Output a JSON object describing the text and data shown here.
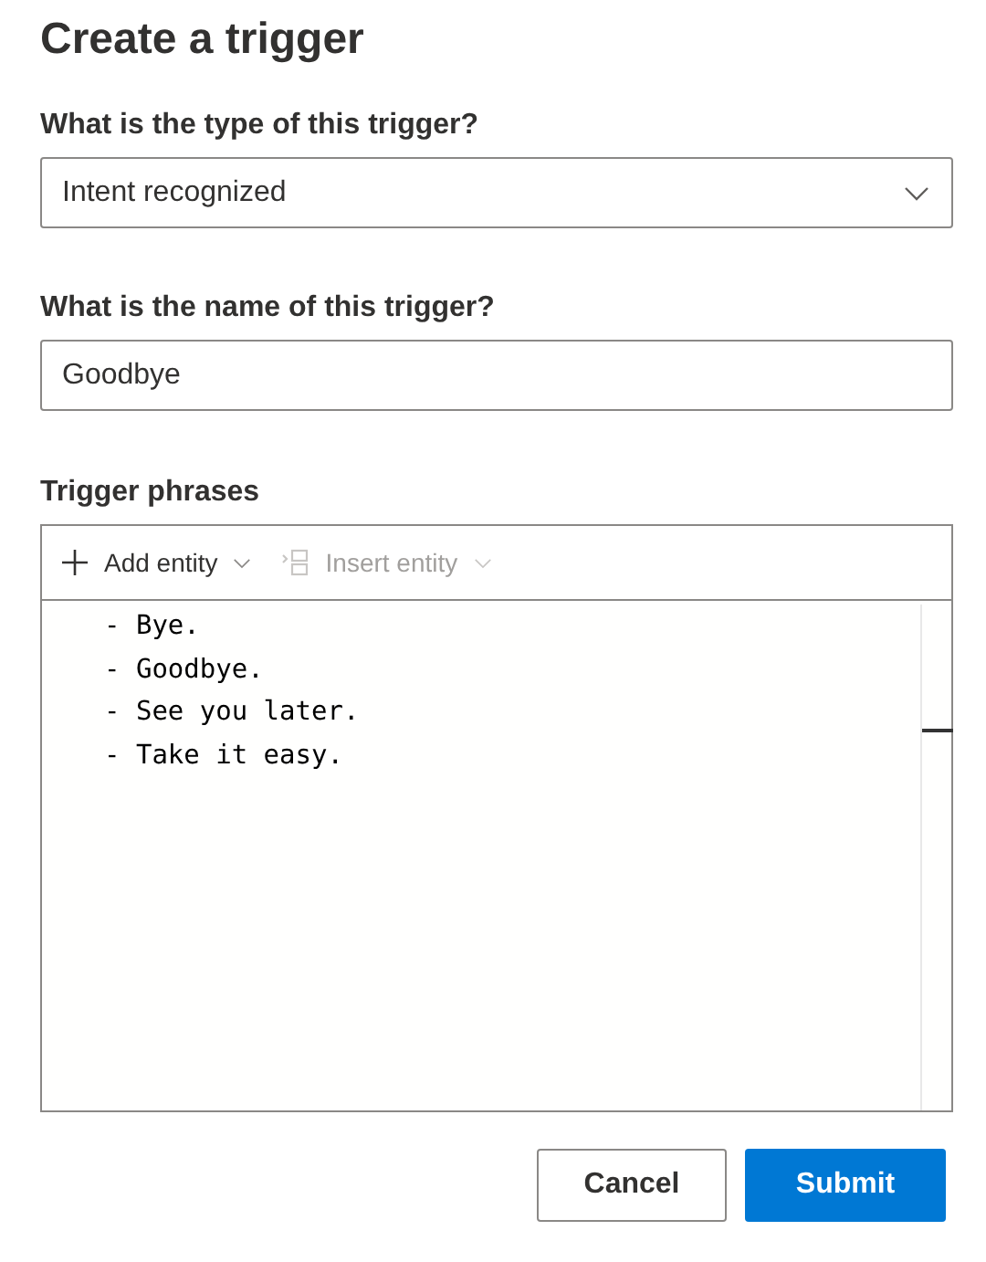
{
  "title": "Create a trigger",
  "type_field": {
    "label": "What is the type of this trigger?",
    "value": "Intent recognized"
  },
  "name_field": {
    "label": "What is the name of this trigger?",
    "value": "Goodbye"
  },
  "phrases": {
    "label": "Trigger phrases",
    "toolbar": [
      {
        "kind": "add",
        "label": "Add entity",
        "disabled": false
      },
      {
        "kind": "insert",
        "label": "Insert entity",
        "disabled": true
      }
    ],
    "lines": [
      "- Bye.",
      "- Goodbye.",
      "- See you later.",
      "- Take it easy."
    ]
  },
  "buttons": [
    {
      "label": "Cancel",
      "kind": "secondary"
    },
    {
      "label": "Submit",
      "kind": "primary"
    }
  ]
}
